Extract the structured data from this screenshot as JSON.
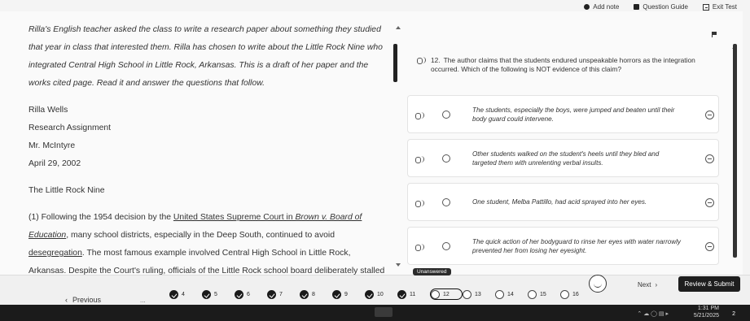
{
  "topbar": {
    "add_note": "Add note",
    "question_guide": "Question Guide",
    "exit_test": "Exit Test"
  },
  "passage": {
    "intro": "Rilla's English teacher asked the class to write a research paper about something they studied that year in class that interested them. Rilla has chosen to write about the Little Rock Nine who integrated Central High School in Little Rock, Arkansas. This is a draft of her paper and the works cited page. Read it and answer the questions that follow.",
    "author": "Rilla Wells",
    "assignment": "Research Assignment",
    "teacher": "Mr. McIntyre",
    "date": "April 29, 2002",
    "title": "The Little Rock Nine",
    "p1_a": "(1) Following the 1954 decision by the ",
    "p1_link1": "United States Supreme Court in ",
    "p1_italic": "Brown v. Board of Education",
    "p1_b": ", many school districts, especially in the Deep South, continued to avoid ",
    "p1_link2": "desegregation",
    "p1_c": ". The most famous example involved Central High School in Little Rock, Arkansas. Despite the Court's ruling, officials of the Little Rock school board deliberately stalled and delayed developing a plan for integration of the district's schools. However, by 1957 the board had finally started the process"
  },
  "question": {
    "number": "12.",
    "text": "The author claims that the students endured unspeakable horrors as the integration occurred. Which of the following is NOT evidence of this claim?"
  },
  "options": [
    {
      "text": "The students, especially the boys, were jumped and beaten until their body guard could intervene."
    },
    {
      "text": "Other students walked on the student's heels until they bled and targeted them with unrelenting verbal insults."
    },
    {
      "text": "One student, Melba Pattillo, had acid sprayed into her eyes."
    },
    {
      "text": "The quick action of her bodyguard to rinse her eyes with water narrowly prevented her from losing her eyesight."
    }
  ],
  "nav": {
    "previous": "Previous",
    "ellipsis": "...",
    "unanswered_tooltip": "Unanswered",
    "next": "Next",
    "review_submit": "Review & Submit",
    "questions": [
      {
        "num": "4",
        "done": true
      },
      {
        "num": "5",
        "done": true
      },
      {
        "num": "6",
        "done": true
      },
      {
        "num": "7",
        "done": true
      },
      {
        "num": "8",
        "done": true
      },
      {
        "num": "9",
        "done": true
      },
      {
        "num": "10",
        "done": true
      },
      {
        "num": "11",
        "done": true
      },
      {
        "num": "12",
        "done": false,
        "current": true
      },
      {
        "num": "13",
        "done": false
      },
      {
        "num": "14",
        "done": false
      },
      {
        "num": "15",
        "done": false
      },
      {
        "num": "16",
        "done": false
      }
    ]
  },
  "taskbar": {
    "time": "1:31 PM",
    "date": "5/21/2025",
    "notification_count": "2"
  }
}
